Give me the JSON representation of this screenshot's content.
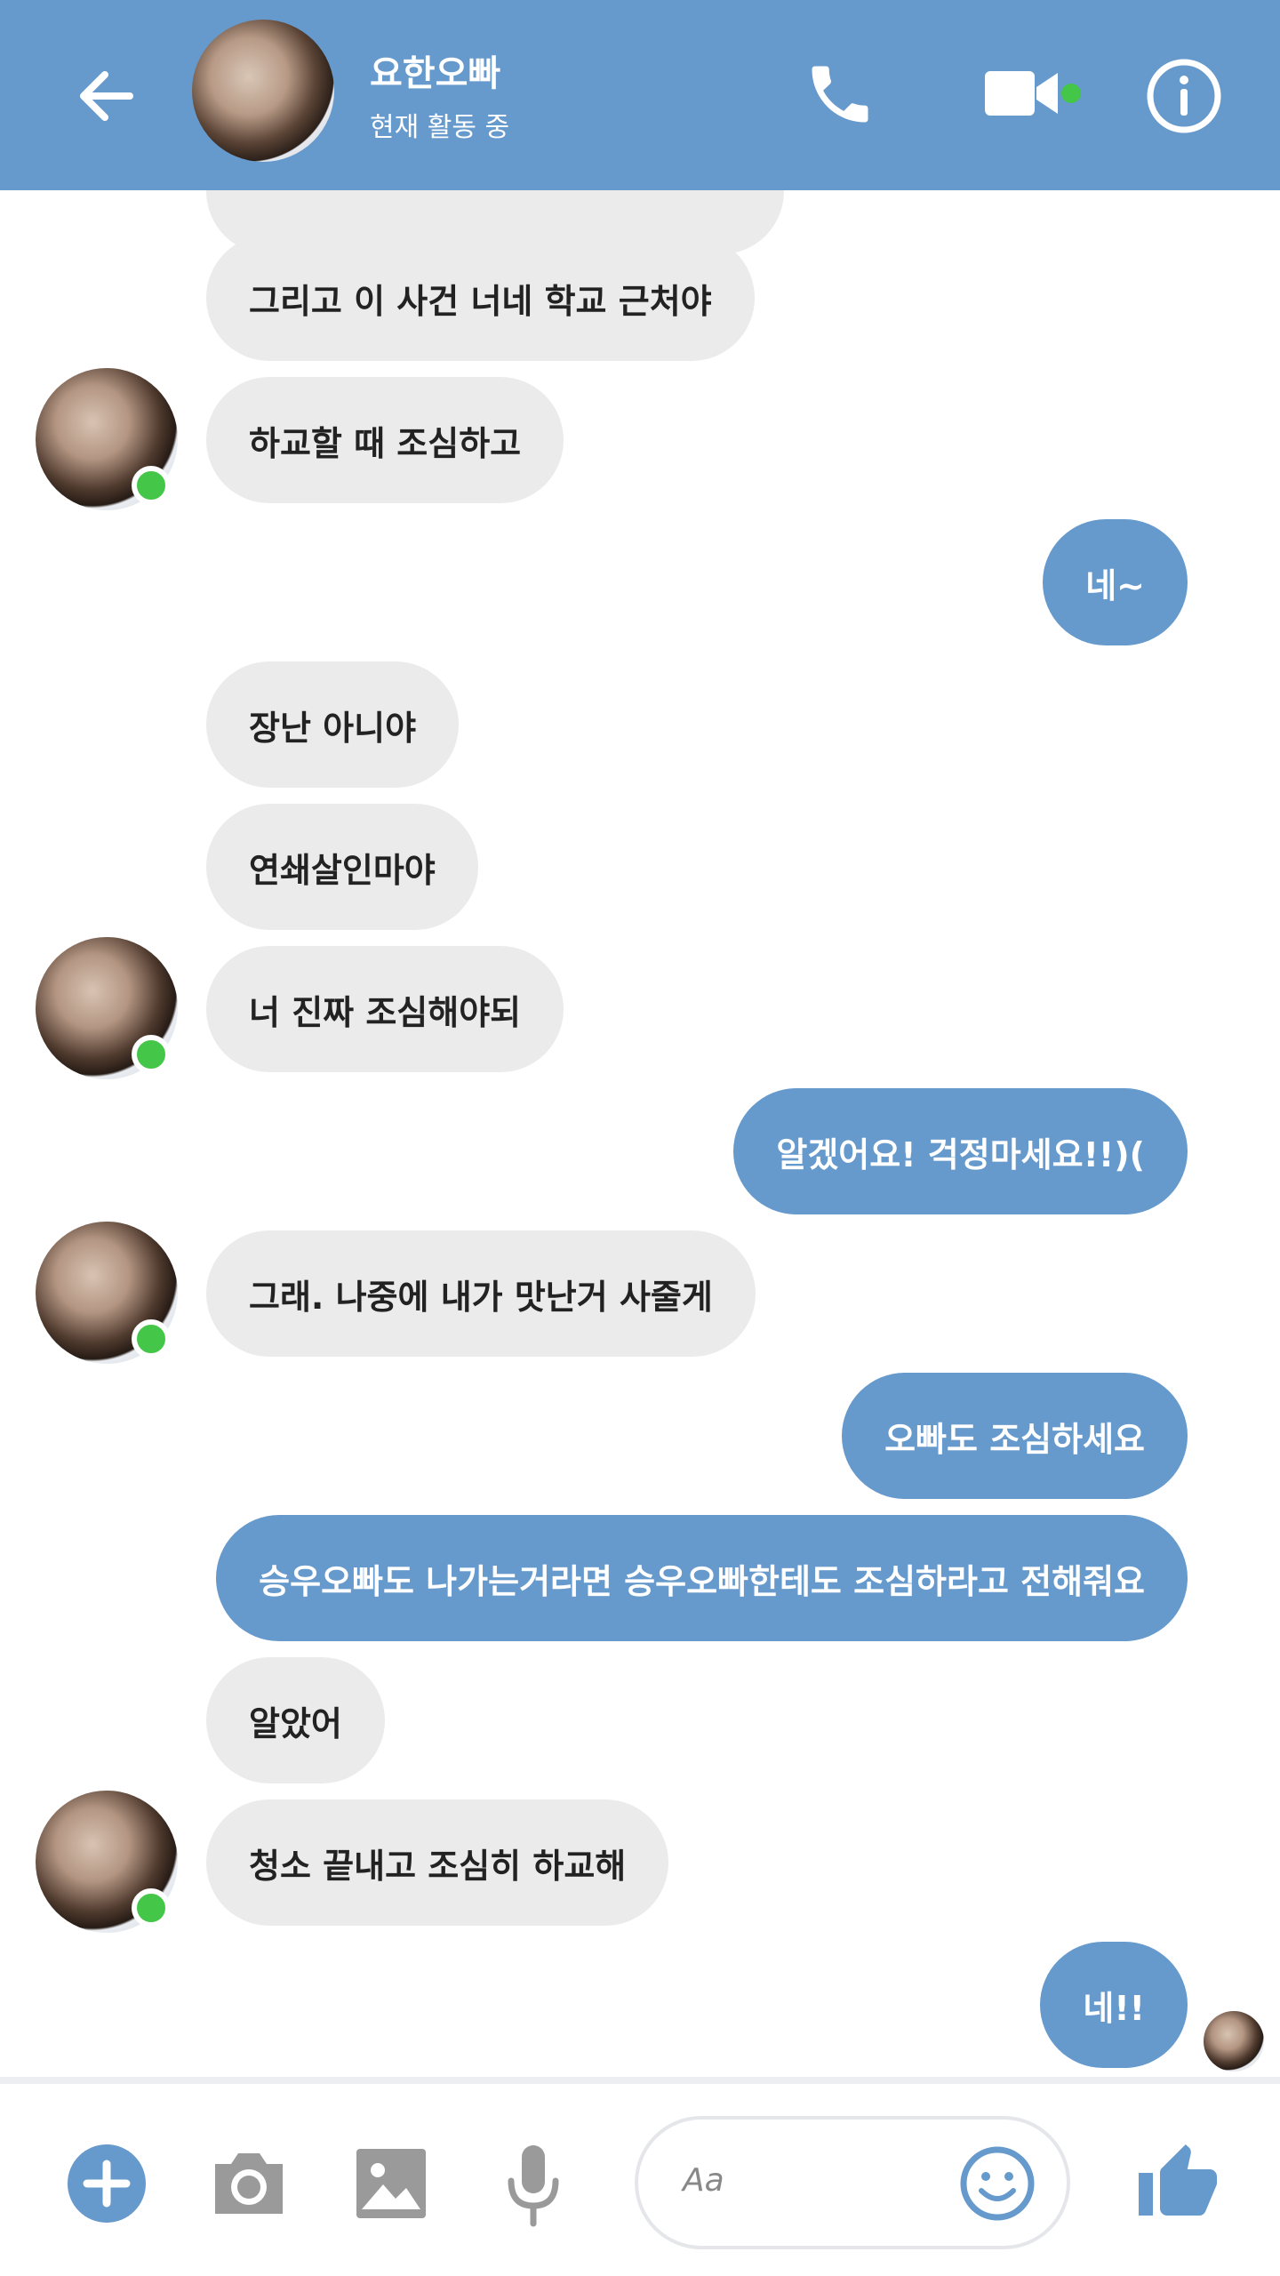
{
  "header": {
    "title": "요한오빠",
    "status": "현재 활동 중"
  },
  "messages": [
    {
      "side": "in",
      "text": "그리고 이 사건 너네 학교 근처야"
    },
    {
      "side": "in",
      "text": "하교할 때 조심하고"
    },
    {
      "side": "out",
      "text": "네~"
    },
    {
      "side": "in",
      "text": "장난 아니야"
    },
    {
      "side": "in",
      "text": "연쇄살인마야"
    },
    {
      "side": "in",
      "text": "너 진짜 조심해야되"
    },
    {
      "side": "out",
      "text": "알겠어요! 걱정마세요!!)("
    },
    {
      "side": "in",
      "text": "그래. 나중에 내가 맛난거 사줄게"
    },
    {
      "side": "out",
      "text": "오빠도 조심하세요"
    },
    {
      "side": "out",
      "text": "승우오빠도 나가는거라면 승우오빠한테도 조심하라고 전해줘요"
    },
    {
      "side": "in",
      "text": "알았어"
    },
    {
      "side": "in",
      "text": "청소 끝내고 조심히 하교해"
    },
    {
      "side": "out",
      "text": "네!!"
    }
  ],
  "composer": {
    "placeholder": "Aa"
  },
  "colors": {
    "accent": "#6699cc",
    "incoming_bubble": "#ebebeb",
    "online": "#44c648"
  },
  "icons": [
    "back-arrow-icon",
    "phone-icon",
    "video-camera-icon",
    "info-icon",
    "plus-icon",
    "camera-icon",
    "image-icon",
    "microphone-icon",
    "emoji-icon",
    "thumbs-up-icon"
  ]
}
